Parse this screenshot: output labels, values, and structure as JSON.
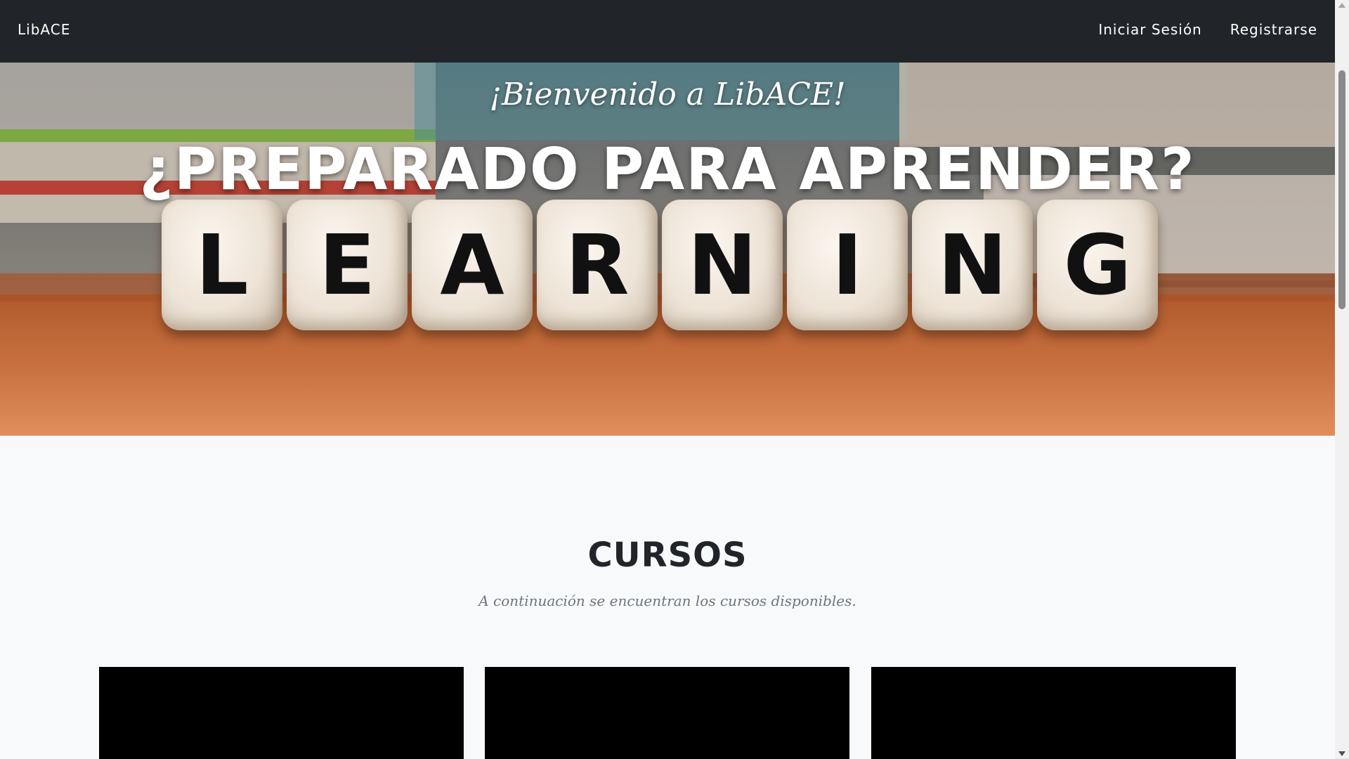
{
  "navbar": {
    "brand": "LibACE",
    "links": [
      {
        "label": "Iniciar Sesión"
      },
      {
        "label": "Registrarse"
      }
    ]
  },
  "hero": {
    "subtitle": "¡Bienvenido a LibACE!",
    "title": "¿PREPARADO PARA APRENDER?",
    "dice_letters": [
      "L",
      "E",
      "A",
      "R",
      "N",
      "I",
      "N",
      "G"
    ]
  },
  "courses": {
    "title": "CURSOS",
    "subtitle": "A continuación se encuentran los cursos disponibles.",
    "card_count": 3
  },
  "colors": {
    "navbar_bg": "#212529",
    "page_bg": "#f8f9fa",
    "heading": "#212529",
    "muted_text": "#6c757d",
    "card_bg": "#000000"
  }
}
